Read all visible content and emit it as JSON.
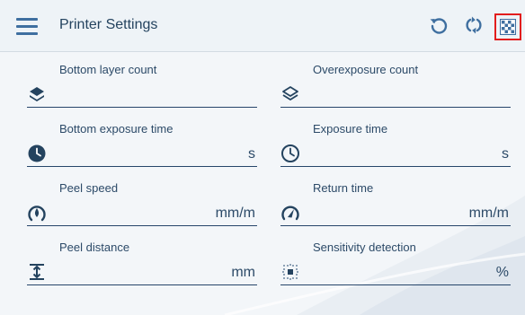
{
  "header": {
    "title": "Printer Settings",
    "icons": [
      "menu-icon",
      "undo-icon",
      "sync-icon",
      "checkerboard-icon"
    ],
    "highlight_color": "#e21d1d"
  },
  "fields": {
    "bottom_layer_count": {
      "label": "Bottom layer count",
      "unit": "",
      "value": "",
      "icon": "layers-filled-icon"
    },
    "overexposure_count": {
      "label": "Overexposure count",
      "unit": "",
      "value": "",
      "icon": "layers-outline-icon"
    },
    "bottom_exposure_time": {
      "label": "Bottom exposure time",
      "unit": "s",
      "value": "",
      "icon": "clock-filled-icon"
    },
    "exposure_time": {
      "label": "Exposure time",
      "unit": "s",
      "value": "",
      "icon": "clock-outline-icon"
    },
    "peel_speed": {
      "label": "Peel speed",
      "unit": "mm/m",
      "value": "",
      "icon": "speed-icon"
    },
    "return_time": {
      "label": "Return time",
      "unit": "mm/m",
      "value": "",
      "icon": "gauge-icon"
    },
    "peel_distance": {
      "label": "Peel distance",
      "unit": "mm",
      "value": "",
      "icon": "distance-icon"
    },
    "sensitivity_detection": {
      "label": "Sensitivity detection",
      "unit": "%",
      "value": "",
      "icon": "sensitivity-icon"
    }
  },
  "colors": {
    "accent": "#3f6fa0",
    "text": "#2c4a68",
    "underline": "#26456a"
  }
}
